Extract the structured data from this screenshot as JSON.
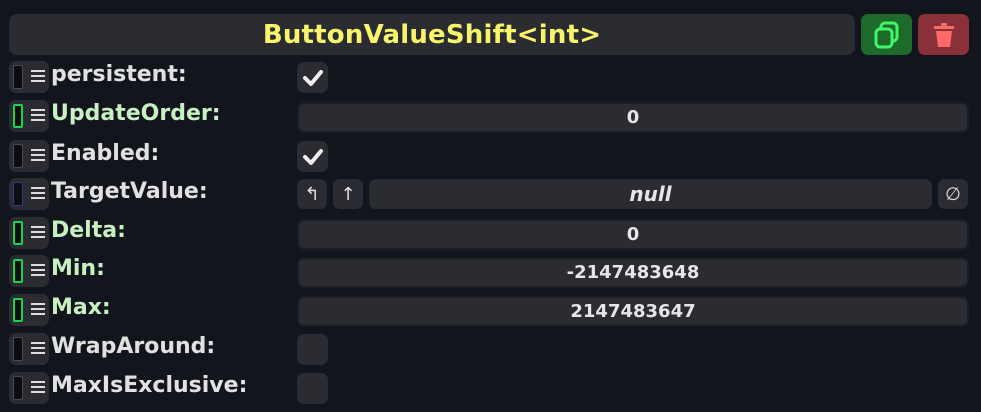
{
  "header": {
    "title": "ButtonValueShift<int>",
    "duplicate_icon": "duplicate-icon",
    "delete_icon": "trash-icon",
    "colors": {
      "title": "#f8f56c",
      "duplicate_bg": "#1e6a2a",
      "delete_bg": "#8a3038"
    }
  },
  "fields": {
    "persistent": {
      "label": "persistent:",
      "checked": true
    },
    "update_order": {
      "label": "UpdateOrder:",
      "value": "0"
    },
    "enabled": {
      "label": "Enabled:",
      "checked": true
    },
    "target_value": {
      "label": "TargetValue:",
      "value": "null",
      "btn1": "↰",
      "btn2": "↑",
      "clear": "∅"
    },
    "delta": {
      "label": "Delta:",
      "value": "0"
    },
    "min": {
      "label": "Min:",
      "value": "-2147483648"
    },
    "max": {
      "label": "Max:",
      "value": "2147483647"
    },
    "wrap_around": {
      "label": "WrapAround:",
      "checked": false
    },
    "max_is_exclusive": {
      "label": "MaxIsExclusive:",
      "checked": false
    }
  },
  "colors": {
    "field_label_green": "#c7f0c3",
    "handle_green": "#17d64a"
  }
}
